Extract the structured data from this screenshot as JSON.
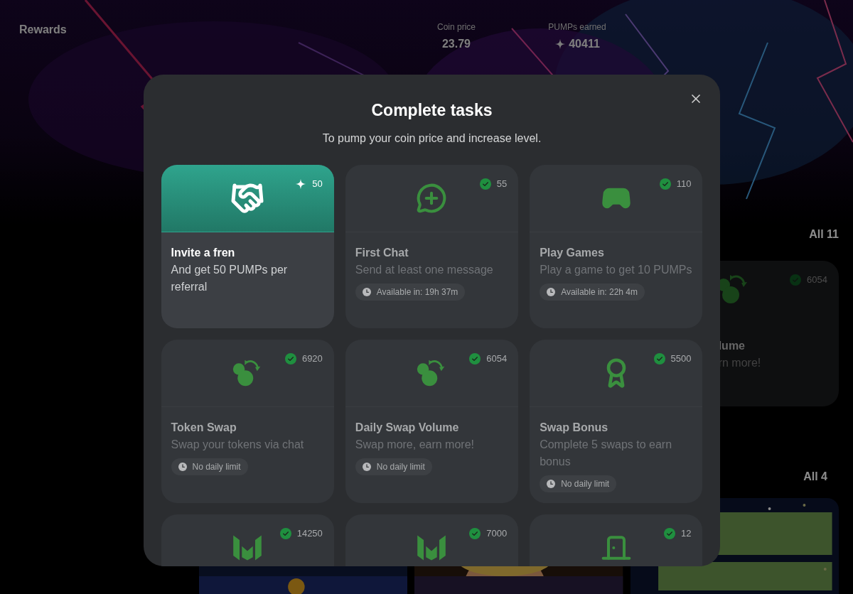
{
  "header": {
    "title": "Rewards",
    "stats": [
      {
        "label": "Coin price",
        "value": "23.79"
      },
      {
        "label": "PUMPs earned",
        "value": "40411"
      }
    ]
  },
  "background": {
    "sections": [
      {
        "link": "All 11"
      },
      {
        "link": "All 4"
      }
    ],
    "partial_card": {
      "badge": "6054",
      "title": "lume",
      "description": "rn more!"
    }
  },
  "modal": {
    "title": "Complete tasks",
    "subtitle": "To pump your coin price and increase level.",
    "tasks": [
      {
        "highlighted": true,
        "completed": false,
        "badge": "50",
        "title": "Invite a fren",
        "description": "And get 50 PUMPs per referral"
      },
      {
        "highlighted": false,
        "completed": true,
        "badge": "55",
        "title": "First Chat",
        "description": "Send at least one message",
        "availability": "Available in: 19h 37m"
      },
      {
        "highlighted": false,
        "completed": true,
        "badge": "110",
        "title": "Play Games",
        "description": "Play a game to get 10 PUMPs",
        "availability": "Available in: 22h 4m"
      },
      {
        "highlighted": false,
        "completed": true,
        "badge": "6920",
        "title": "Token Swap",
        "description": "Swap your tokens via chat",
        "availability": "No daily limit"
      },
      {
        "highlighted": false,
        "completed": true,
        "badge": "6054",
        "title": "Daily Swap Volume",
        "description": "Swap more, earn more!",
        "availability": "No daily limit"
      },
      {
        "highlighted": false,
        "completed": true,
        "badge": "5500",
        "title": "Swap Bonus",
        "description": "Complete 5 swaps to earn bonus",
        "availability": "No daily limit"
      },
      {
        "highlighted": false,
        "completed": true,
        "badge": "14250"
      },
      {
        "highlighted": false,
        "completed": true,
        "badge": "7000"
      },
      {
        "highlighted": false,
        "completed": true,
        "badge": "12"
      }
    ]
  }
}
